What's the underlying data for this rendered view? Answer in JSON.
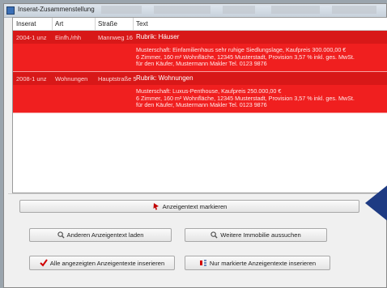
{
  "window": {
    "title": "Inserat-Zusammenstellung"
  },
  "table": {
    "headers": [
      "Inserat",
      "Art",
      "Straße",
      "Text"
    ],
    "rows": [
      {
        "inserat": "2004-1 unz",
        "art": "Einfh./rhh",
        "strasse": "Mannweg 16",
        "rubric": "Rubrik: Häuser",
        "text_lines": [
          "Musterschaft: Einfamilienhaus sehr ruhige Siedlungslage, Kaufpreis 300.000,00 €",
          "6 Zimmer, 160 m² Wohnfläche, 12345 Musterstadt, Provision 3,57 % inkl. ges. MwSt.",
          "für den Käufer, Mustermann Makler Tel. 0123 9876"
        ]
      },
      {
        "inserat": "2008-1 unz",
        "art": "Wohnungen",
        "strasse": "Hauptstraße 5",
        "rubric": "Rubrik: Wohnungen",
        "text_lines": [
          "Musterschaft: Luxus-Penthouse, Kaufpreis 250.000,00 €",
          "6 Zimmer, 160 m² Wohnfläche, 12345 Musterstadt, Provision 3,57 % inkl. ges. MwSt.",
          "für den Käufer, Mustermann Makler Tel. 0123 9876"
        ]
      }
    ]
  },
  "buttons": {
    "mark": "Anzeigentext markieren",
    "load_other": "Anderen Anzeigentext laden",
    "search_property": "Weitere Immobilie aussuchen",
    "insert_all": "Alle angezeigten Anzeigentexte inserieren",
    "insert_marked": "Nur markierte Anzeigentexte inserieren"
  },
  "icons": {
    "mark": "cursor-arrow-icon",
    "load_other": "magnifier-icon",
    "search_property": "magnifier-icon",
    "insert_all": "red-checkmark-icon",
    "insert_marked": "marked-text-icon",
    "annotation": "blue-arrow-pointer"
  },
  "colors": {
    "row": "#f01f1f",
    "annotation": "#1e3b83"
  }
}
